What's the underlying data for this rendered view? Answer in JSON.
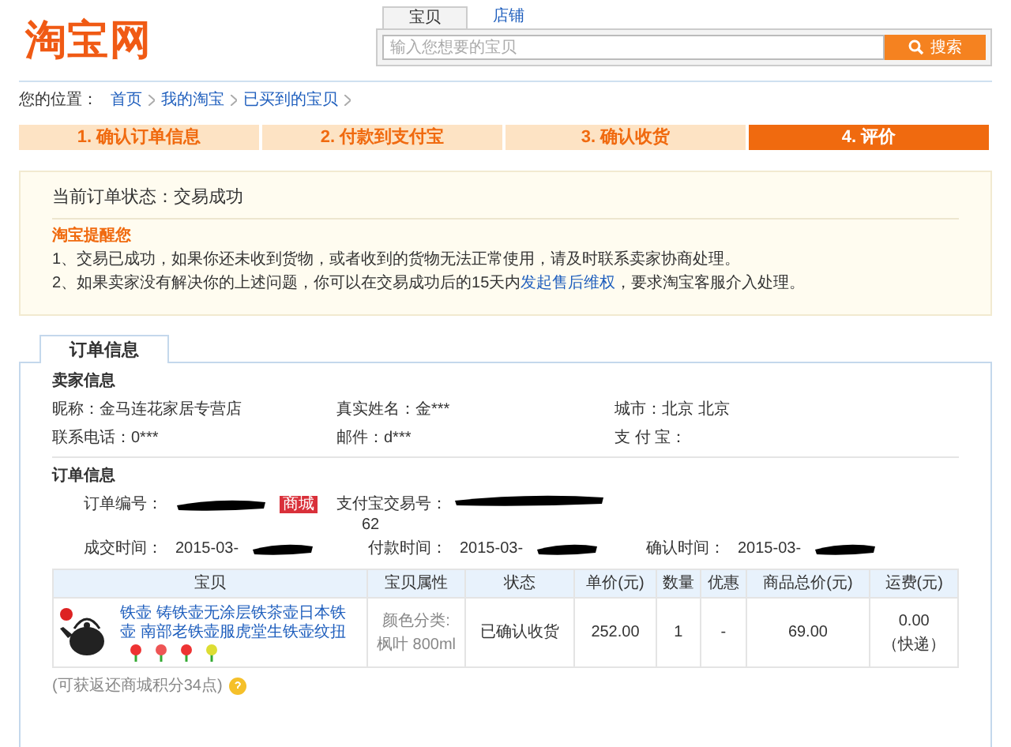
{
  "header": {
    "logo": "淘宝网",
    "search_tabs": [
      {
        "label": "宝贝",
        "selected": true
      },
      {
        "label": "店铺",
        "selected": false
      }
    ],
    "search": {
      "placeholder": "输入您想要的宝贝",
      "button": "搜索"
    }
  },
  "breadcrumb": {
    "label": "您的位置：",
    "items": [
      "首页",
      "我的淘宝",
      "已买到的宝贝"
    ]
  },
  "steps": [
    {
      "label": "1. 确认订单信息",
      "selected": false
    },
    {
      "label": "2. 付款到支付宝",
      "selected": false
    },
    {
      "label": "3. 确认收货",
      "selected": false
    },
    {
      "label": "4. 评价",
      "selected": true
    }
  ],
  "notice": {
    "status": "当前订单状态：交易成功",
    "title": "淘宝提醒您",
    "lines": [
      {
        "text": "1、交易已成功，如果你还未收到货物，或者收到的货物无法正常使用，请及时联系卖家协商处理。"
      },
      {
        "text": "2、如果卖家没有解决你的上述问题，你可以在交易成功后的15天内",
        "link": "发起售后维权",
        "after": "，要求淘宝客服介入处理。"
      }
    ]
  },
  "tab": {
    "label": "订单信息",
    "selected": true
  },
  "seller": {
    "title": "卖家信息",
    "fields": [
      {
        "label": "昵称：",
        "value": "金马连花家居专营店"
      },
      {
        "label": "真实姓名：",
        "value": "金***"
      },
      {
        "label": "城市：",
        "value": "北京 北京"
      },
      {
        "label": "联系电话：",
        "value": "0***"
      },
      {
        "label": "邮件：",
        "value": "d***"
      },
      {
        "label": "支 付 宝："
      }
    ]
  },
  "order": {
    "title": "订单信息",
    "order_no_label": "订单编号：",
    "mall_badge": "商城",
    "alipay_label": "支付宝交易号：",
    "alipay_partial": "62",
    "times": [
      {
        "label": "成交时间：",
        "value": "2015-03-"
      },
      {
        "label": "付款时间：",
        "value": "2015-03-"
      },
      {
        "label": "确认时间：",
        "value": "2015-03-"
      }
    ]
  },
  "table": {
    "columns": [
      "宝贝",
      "宝贝属性",
      "状态",
      "单价(元)",
      "数量",
      "优惠",
      "商品总价(元)",
      "运费(元)"
    ],
    "rows": [
      {
        "title": "铁壶 铸铁壶无涂层铁茶壶日本铁壶 南部老铁壶服虎堂生铁壶纹扭",
        "attr": "颜色分类: 枫叶 800ml",
        "status": "已确认收货",
        "price": "252.00",
        "qty": "1",
        "discount": "-",
        "total": "69.00",
        "shipping": "0.00",
        "shipping_method": "（快递）"
      }
    ]
  },
  "points": "(可获返还商城积分34点)"
}
